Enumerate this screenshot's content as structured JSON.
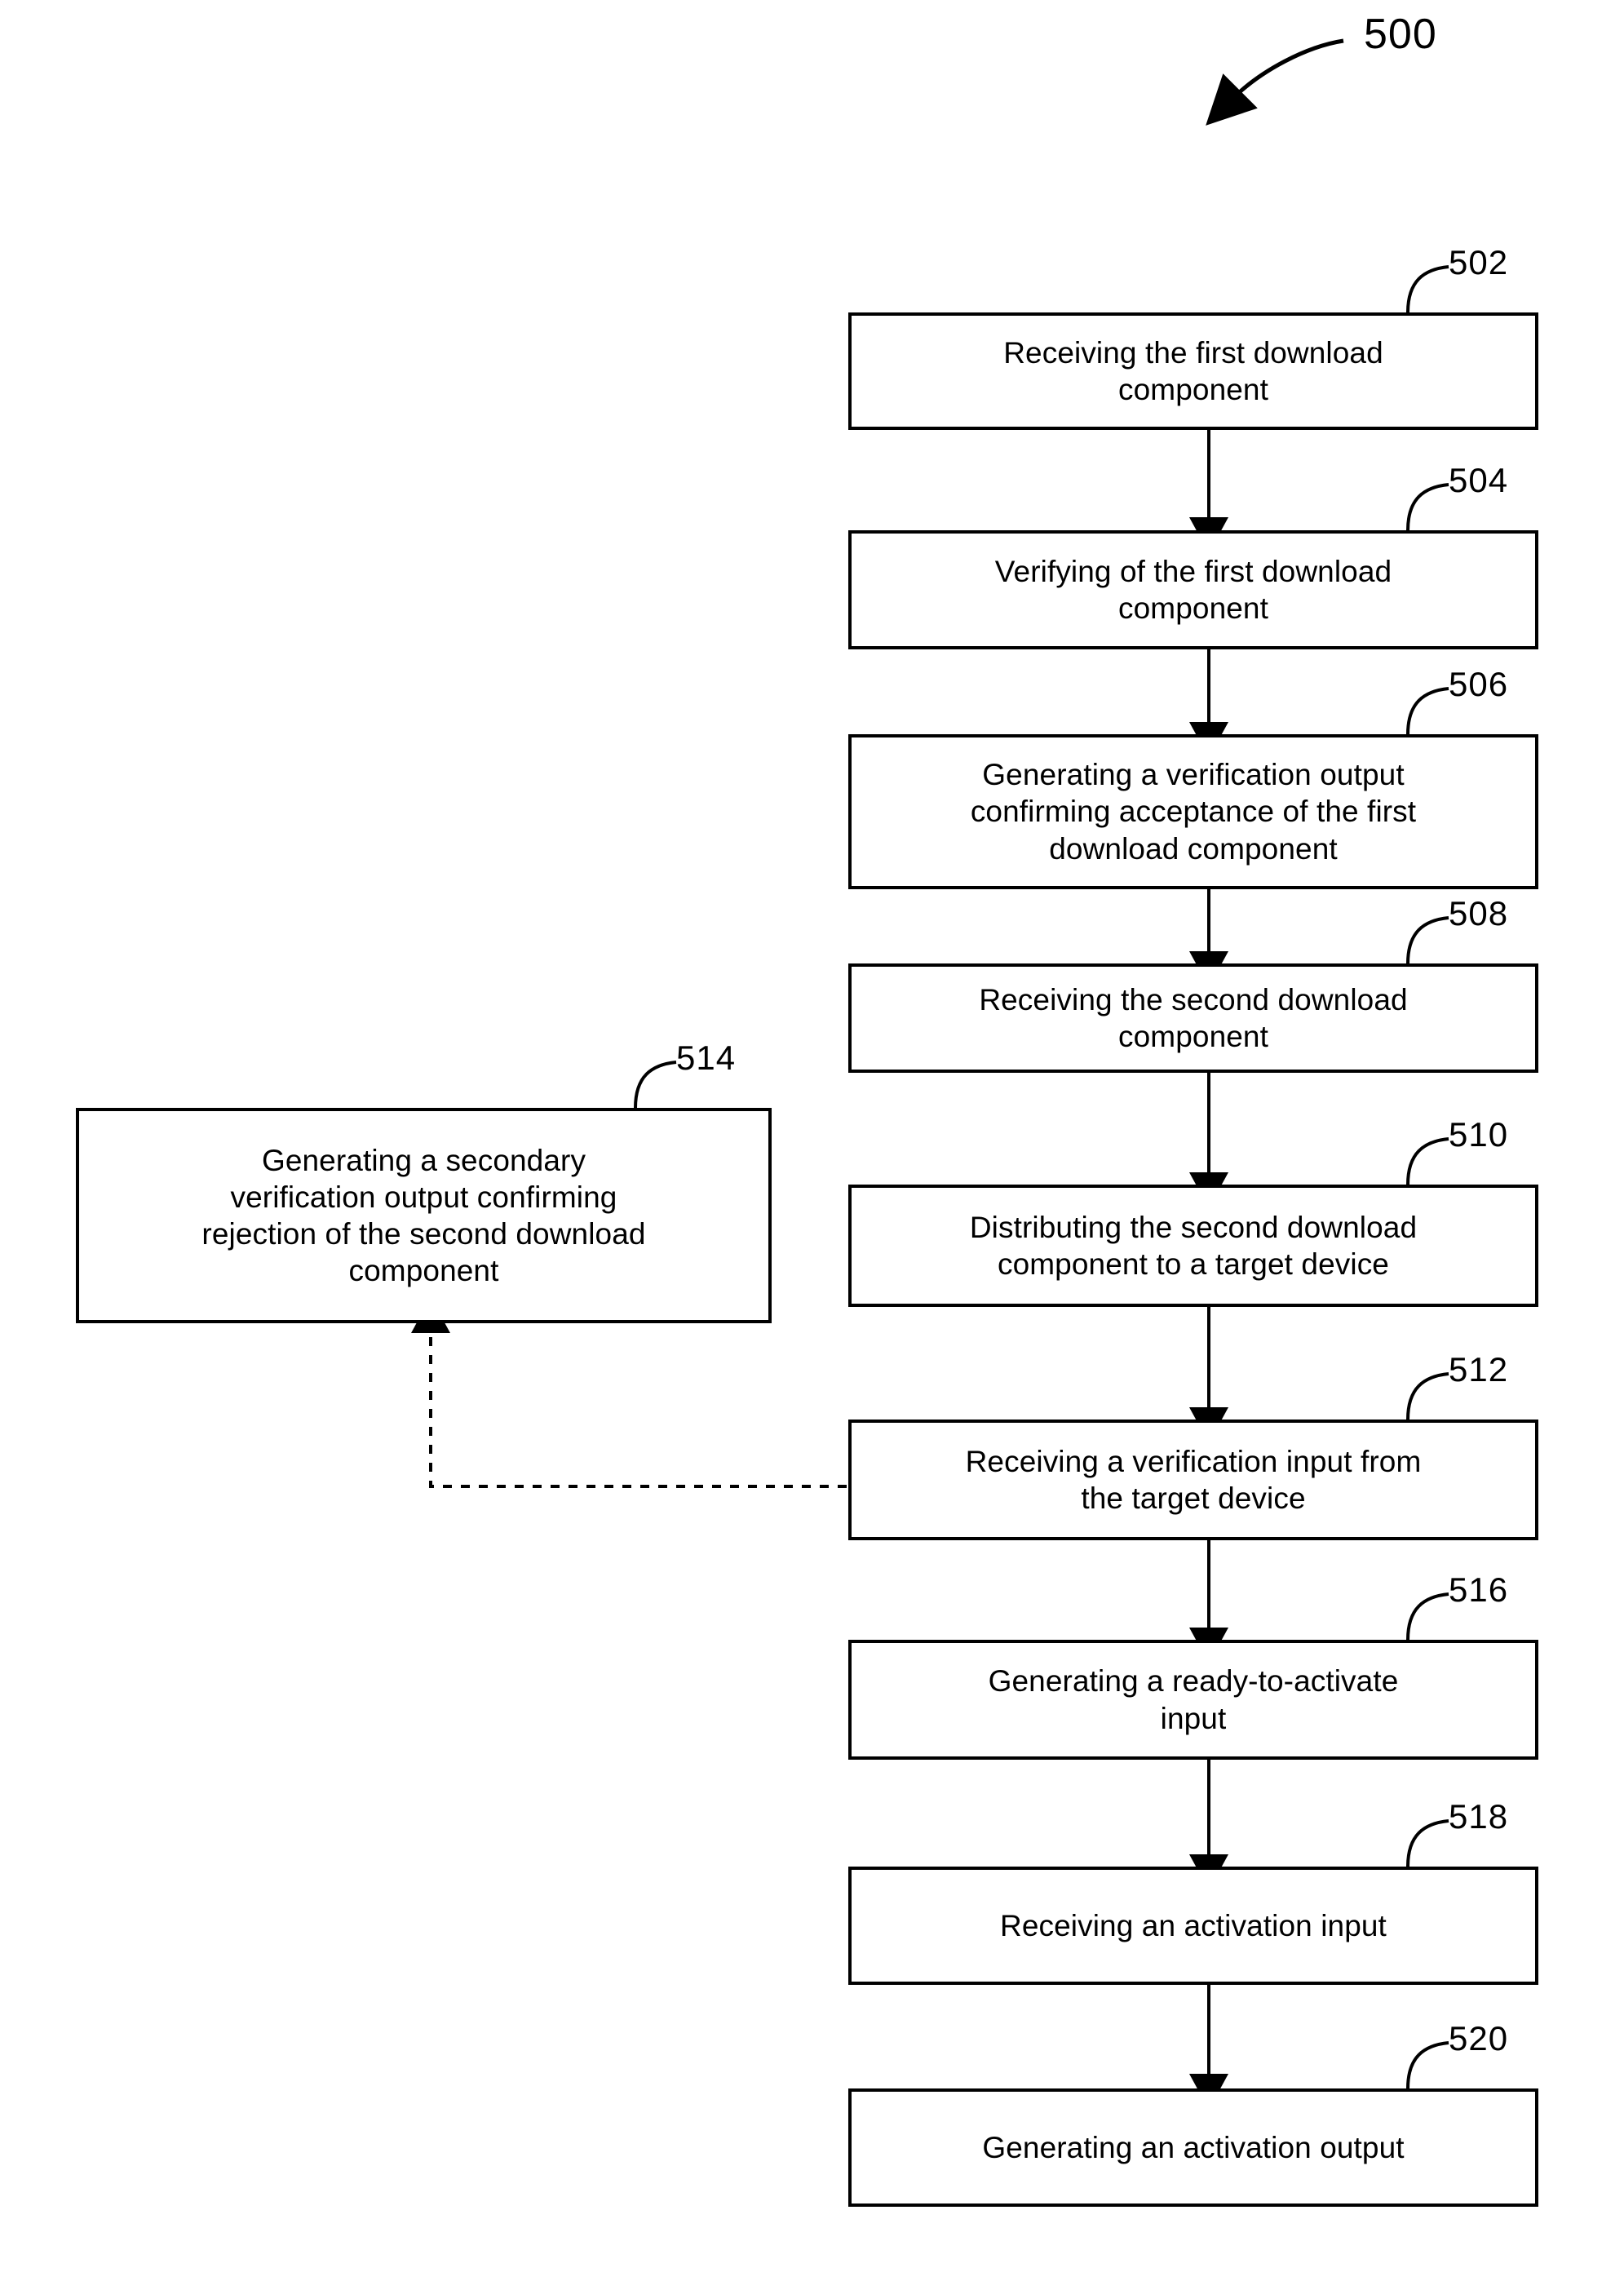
{
  "figure": {
    "number": "500",
    "type": "patent-flowchart"
  },
  "nodes": [
    {
      "ref": "502",
      "text": "Receiving the first download\ncomponent"
    },
    {
      "ref": "504",
      "text": "Verifying of the first download\ncomponent"
    },
    {
      "ref": "506",
      "text": "Generating a verification output\nconfirming acceptance of the first\ndownload component"
    },
    {
      "ref": "508",
      "text": "Receiving the second download\ncomponent"
    },
    {
      "ref": "510",
      "text": "Distributing the second download\ncomponent to a target device"
    },
    {
      "ref": "512",
      "text": "Receiving a verification input from\nthe target device"
    },
    {
      "ref": "514",
      "text": "Generating a secondary\nverification output confirming\nrejection of the second download\ncomponent"
    },
    {
      "ref": "516",
      "text": "Generating a ready-to-activate\ninput"
    },
    {
      "ref": "518",
      "text": "Receiving an activation input"
    },
    {
      "ref": "520",
      "text": "Generating an activation output"
    }
  ],
  "connectors": [
    {
      "from": "502",
      "to": "504",
      "style": "solid-arrow"
    },
    {
      "from": "504",
      "to": "506",
      "style": "solid-arrow"
    },
    {
      "from": "506",
      "to": "508",
      "style": "solid-arrow"
    },
    {
      "from": "508",
      "to": "510",
      "style": "solid-arrow"
    },
    {
      "from": "510",
      "to": "512",
      "style": "solid-arrow"
    },
    {
      "from": "512",
      "to": "514",
      "style": "dashed-arrow"
    },
    {
      "from": "512",
      "to": "516",
      "style": "solid-arrow"
    },
    {
      "from": "516",
      "to": "518",
      "style": "solid-arrow"
    },
    {
      "from": "518",
      "to": "520",
      "style": "solid-arrow"
    }
  ],
  "colors": {
    "stroke": "#000000",
    "fill": "#ffffff",
    "text": "#000000"
  }
}
